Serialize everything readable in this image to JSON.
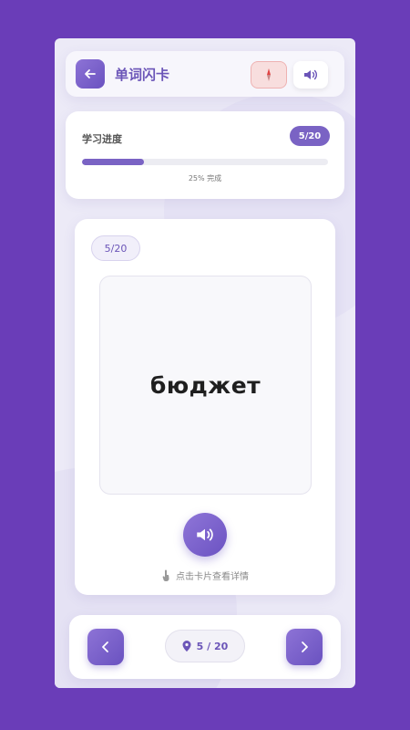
{
  "header": {
    "title": "单词闪卡",
    "back_icon": "arrow-left-icon",
    "compass_icon": "compass-icon",
    "sound_icon": "speaker-icon"
  },
  "progress": {
    "label": "学习进度",
    "badge": "5/20",
    "percent": 25,
    "text": "25% 完成"
  },
  "card": {
    "counter": "5/20",
    "word": "бюджет",
    "play_icon": "speaker-icon",
    "hint": "点击卡片查看详情",
    "hint_icon": "tap-hand-icon"
  },
  "nav": {
    "prev_icon": "chevron-left-icon",
    "next_icon": "chevron-right-icon",
    "pin_icon": "map-pin-icon",
    "counter": "5 / 20"
  },
  "colors": {
    "background": "#6a3db8",
    "accent": "#7a63c4",
    "compass_bg": "#f8dede"
  }
}
